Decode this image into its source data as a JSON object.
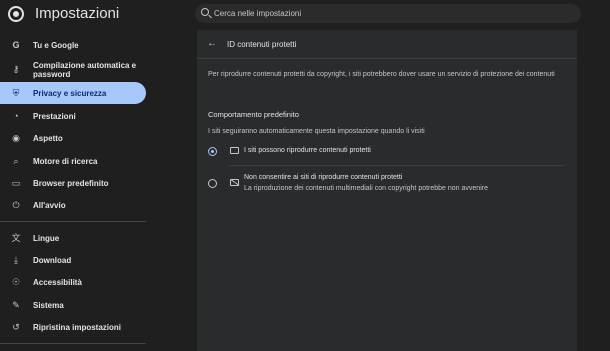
{
  "header": {
    "title": "Impostazioni",
    "search_placeholder": "Cerca nelle impostazioni"
  },
  "sidebar": {
    "items": [
      {
        "label": "Tu e Google",
        "icon": "google-icon",
        "active": false
      },
      {
        "label": "Compilazione automatica e\npassword",
        "icon": "key-icon",
        "active": false
      },
      {
        "label": "Privacy e sicurezza",
        "icon": "shield-icon",
        "active": true
      },
      {
        "label": "Prestazioni",
        "icon": "speedometer-icon",
        "active": false
      },
      {
        "label": "Aspetto",
        "icon": "palette-icon",
        "active": false
      },
      {
        "label": "Motore di ricerca",
        "icon": "search-icon",
        "active": false
      },
      {
        "label": "Browser predefinito",
        "icon": "browser-icon",
        "active": false
      },
      {
        "label": "All'avvio",
        "icon": "power-icon",
        "active": false
      },
      {
        "label": "Lingue",
        "icon": "translate-icon",
        "active": false
      },
      {
        "label": "Download",
        "icon": "download-icon",
        "active": false
      },
      {
        "label": "Accessibilità",
        "icon": "accessibility-icon",
        "active": false
      },
      {
        "label": "Sistema",
        "icon": "wrench-icon",
        "active": false
      },
      {
        "label": "Ripristina impostazioni",
        "icon": "reset-icon",
        "active": false
      }
    ]
  },
  "panel": {
    "title": "ID contenuti protetti",
    "description": "Per riprodurre contenuti protetti da copyright, i siti potrebbero dover usare un servizio di protezione dei contenuti",
    "section_title": "Comportamento predefinito",
    "section_subtitle": "I siti seguiranno automaticamente questa impostazione quando li visiti",
    "options": [
      {
        "label": "I siti possono riprodurre contenuti protetti",
        "sublabel": "",
        "checked": true,
        "icon": "monitor-icon"
      },
      {
        "label": "Non consentire ai siti di riprodurre contenuti protetti",
        "sublabel": "La riproduzione dei contenuti multimediali con copyright potrebbe non avvenire",
        "checked": false,
        "icon": "monitor-blocked-icon"
      }
    ]
  },
  "colors": {
    "background": "#1f1f1f",
    "panel": "#2a2b2d",
    "accent": "#a8c7fa",
    "active_text": "#062e6f"
  }
}
